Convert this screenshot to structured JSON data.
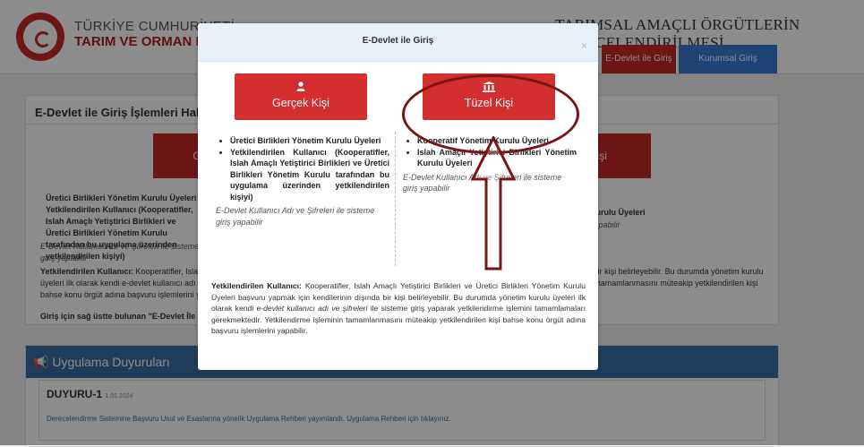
{
  "header": {
    "org_line1": "TÜRKİYE CUMHURİYETİ",
    "org_line2": "TARIM VE ORMAN BAKANLIĞI",
    "system_title": "TARIMSAL AMAÇLI ÖRGÜTLERİN DERECELENDİRİLMESİ",
    "edevlet_button": "E-Devlet ile Giriş",
    "kurumsal_button": "Kurumsal Giriş"
  },
  "background": {
    "card_title": "E-Devlet ile Giriş İşlemleri Hakkında",
    "left_button": "Gerçek Kişi",
    "right_button": "Tüzel Kişi",
    "bullets": [
      "Üretici Birlikleri Yönetim Kurulu Üyeleri",
      "Yetkilendirilen Kullanıcı (Kooperatifler, Islah Amaçlı Yetiştirici Birlikleri ve Üretici Birlikleri Yönetim Kurulu tarafından bu uygulama üzerinden yetkilendirilen kişiyi)"
    ],
    "right_bullet": "Kurulu Üyeleri",
    "right_note": "yapabilir",
    "note": "E-Devlet Kullanıcı Adı ve Şifreleri ile sisteme giriş yapabilir",
    "para_label": "Yetkilendirilen Kullanıcı:",
    "para_text": "Kooperatifler, Islah Amaçlı Yetiştirici Birlikleri ve Üretici Birlikleri Yönetim Kurulu Üyeleri başvuru yapmak için kendilerinin dışında bir kişi belirleyebilir. Bu durumda yönetim kurulu üyeleri ilk olarak kendi e-devlet kullanıcı adı ve şifreleri ile sisteme giriş yaparak yetkilendirme işlemini tamamlamaları gerekmektedir. Yetkilendirme işleminin tamamlanmasını müteakip yetkilendirilen kişi bahse konu örgüt adına başvuru işlemlerini yapabilir.",
    "login_hint": "Giriş için sağ üstte bulunan \"E-Devlet İle Giriş\" butonunu kullanınız.",
    "announce_title": "Uygulama Duyuruları",
    "duyuru_title": "DUYURU-1",
    "duyuru_date": "1.01.2024",
    "duyuru_text": "Derecelendirme Sistemine Başvuru Usul ve Esaslarına yönelik Uygulama Rehberi yayımlandı. Uygulama Rehberi için tıklayınız."
  },
  "modal": {
    "title": "E-Devlet ile Giriş",
    "close": "×",
    "btn_gercek": {
      "icon": "person-icon",
      "label": "Gerçek Kişi"
    },
    "btn_tuzel": {
      "icon": "institution-icon",
      "label": "Tüzel Kişi"
    },
    "left_bullets": [
      "Üretici Birlikleri Yönetim Kurulu Üyeleri",
      "Yetkilendirilen Kullanıcı (Kooperatifler, Islah Amaçlı Yetiştirici Birlikleri ve Üretici Birlikleri Yönetim Kurulu tarafından bu uygulama üzerinden yetkilendirilen kişiyi)"
    ],
    "left_note": "E-Devlet Kullanıcı Adı ve Şifreleri ile sisteme giriş yapabilir",
    "right_bullets": [
      "Kooperatif Yönetim Kurulu Üyeleri",
      "Islah Amaçlı Yetiştirici Birlikleri Yönetim Kurulu Üyeleri"
    ],
    "right_note": "E-Devlet Kullanıcı Adı ve Şifreleri ile sisteme giriş yapabilir",
    "body_label": "Yetkilendirilen Kullanıcı:",
    "body_pre": "Kooperatifler, Islah Amaçlı Yetiştirici Birlikleri ve Üretici Birlikleri Yönetim Kurulu Üyeleri başvuru yapmak için kendilerinin dışında bir kişi belirleyebilir. Bu durumda yönetim kurulu üyeleri ilk olarak kendi",
    "body_em": "e-devlet kullanıcı adı ve şifreleri",
    "body_post": "ile sisteme giriş yaparak yetkilendirme işlemini tamamlamaları gerekmektedir. Yetkilendirme işleminin tamamlanmasını müteakip yetkilendirilen kişi bahse konu örgüt adına başvuru işlemlerini yapabilir."
  },
  "colors": {
    "brand_red": "#c62828",
    "button_red": "#d32f2f",
    "annotation": "#7a1515",
    "link_blue": "#3a6ea5"
  }
}
